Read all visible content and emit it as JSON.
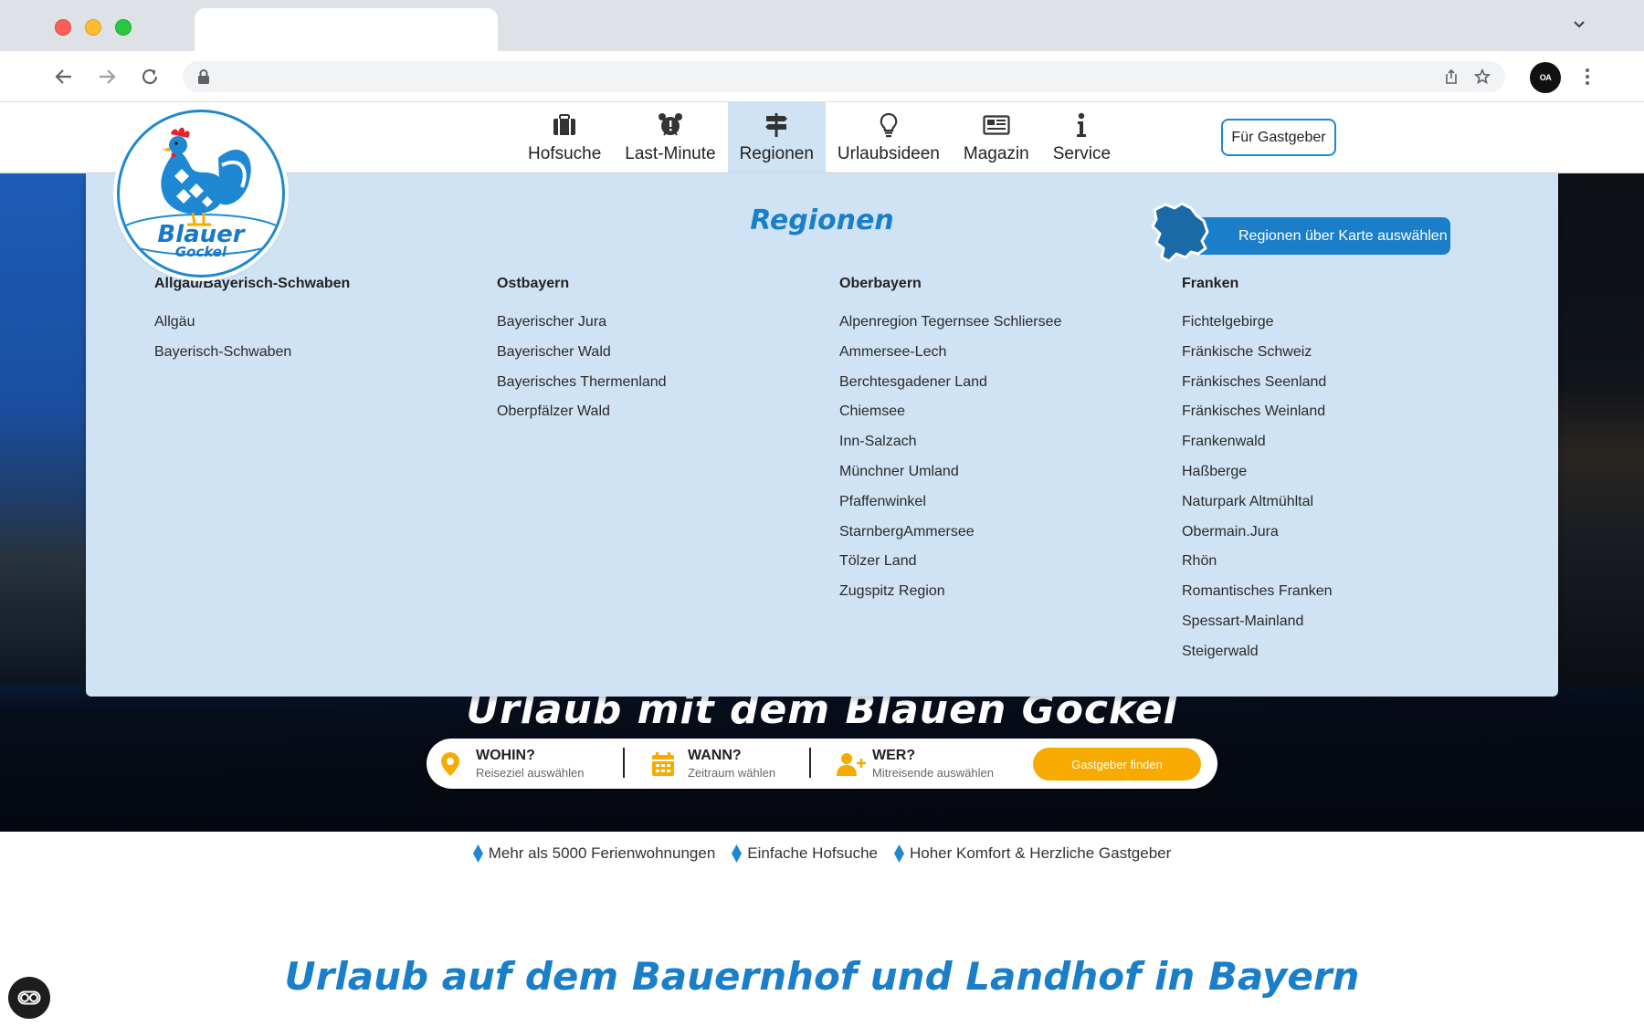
{
  "browser": {
    "url": "",
    "profile_initials": "OA"
  },
  "site": {
    "logo": {
      "line1": "Blauer",
      "line2": "Gockel"
    },
    "nav": [
      {
        "label": "Hofsuche",
        "icon": "suitcase-icon",
        "active": false
      },
      {
        "label": "Last-Minute",
        "icon": "alarm-clock-icon",
        "active": false
      },
      {
        "label": "Regionen",
        "icon": "signpost-icon",
        "active": true
      },
      {
        "label": "Urlaubsideen",
        "icon": "lightbulb-icon",
        "active": false
      },
      {
        "label": "Magazin",
        "icon": "newspaper-icon",
        "active": false
      },
      {
        "label": "Service",
        "icon": "info-icon",
        "active": false
      }
    ],
    "host_button": "Für Gastgeber"
  },
  "regions_menu": {
    "title": "Regionen",
    "map_button": "Regionen über Karte auswählen",
    "columns": [
      {
        "heading": "Allgäu/Bayerisch-Schwaben",
        "items": [
          "Allgäu",
          "Bayerisch-Schwaben"
        ]
      },
      {
        "heading": "Ostbayern",
        "items": [
          "Bayerischer Jura",
          "Bayerischer Wald",
          "Bayerisches Thermenland",
          "Oberpfälzer Wald"
        ]
      },
      {
        "heading": "Oberbayern",
        "items": [
          "Alpenregion Tegernsee Schliersee",
          "Ammersee-Lech",
          "Berchtesgadener Land",
          "Chiemsee",
          "Inn-Salzach",
          "Münchner Umland",
          "Pfaffenwinkel",
          "StarnbergAmmersee",
          "Tölzer Land",
          "Zugspitz Region"
        ]
      },
      {
        "heading": "Franken",
        "items": [
          "Fichtelgebirge",
          "Fränkische Schweiz",
          "Fränkisches Seenland",
          "Fränkisches Weinland",
          "Frankenwald",
          "Haßberge",
          "Naturpark Altmühltal",
          "Obermain.Jura",
          "Rhön",
          "Romantisches Franken",
          "Spessart-Mainland",
          "Steigerwald"
        ]
      }
    ]
  },
  "hero": {
    "title": "Urlaub mit dem Blauen Gockel"
  },
  "search": {
    "where": {
      "label": "WOHIN?",
      "sub": "Reiseziel auswählen"
    },
    "when": {
      "label": "WANN?",
      "sub": "Zeitraum wählen"
    },
    "who": {
      "label": "WER?",
      "sub": "Mitreisende auswählen"
    },
    "button": "Gastgeber finden"
  },
  "usps": [
    "Mehr als 5000 Ferienwohnungen",
    "Einfache Hofsuche",
    "Hoher Komfort & Herzliche Gastgeber"
  ],
  "page_title": "Urlaub auf dem Bauernhof und Landhof in Bayern",
  "colors": {
    "brand_blue": "#1a7fc8",
    "menu_bg": "#cfe3f4",
    "accent_orange": "#f7ab00"
  }
}
